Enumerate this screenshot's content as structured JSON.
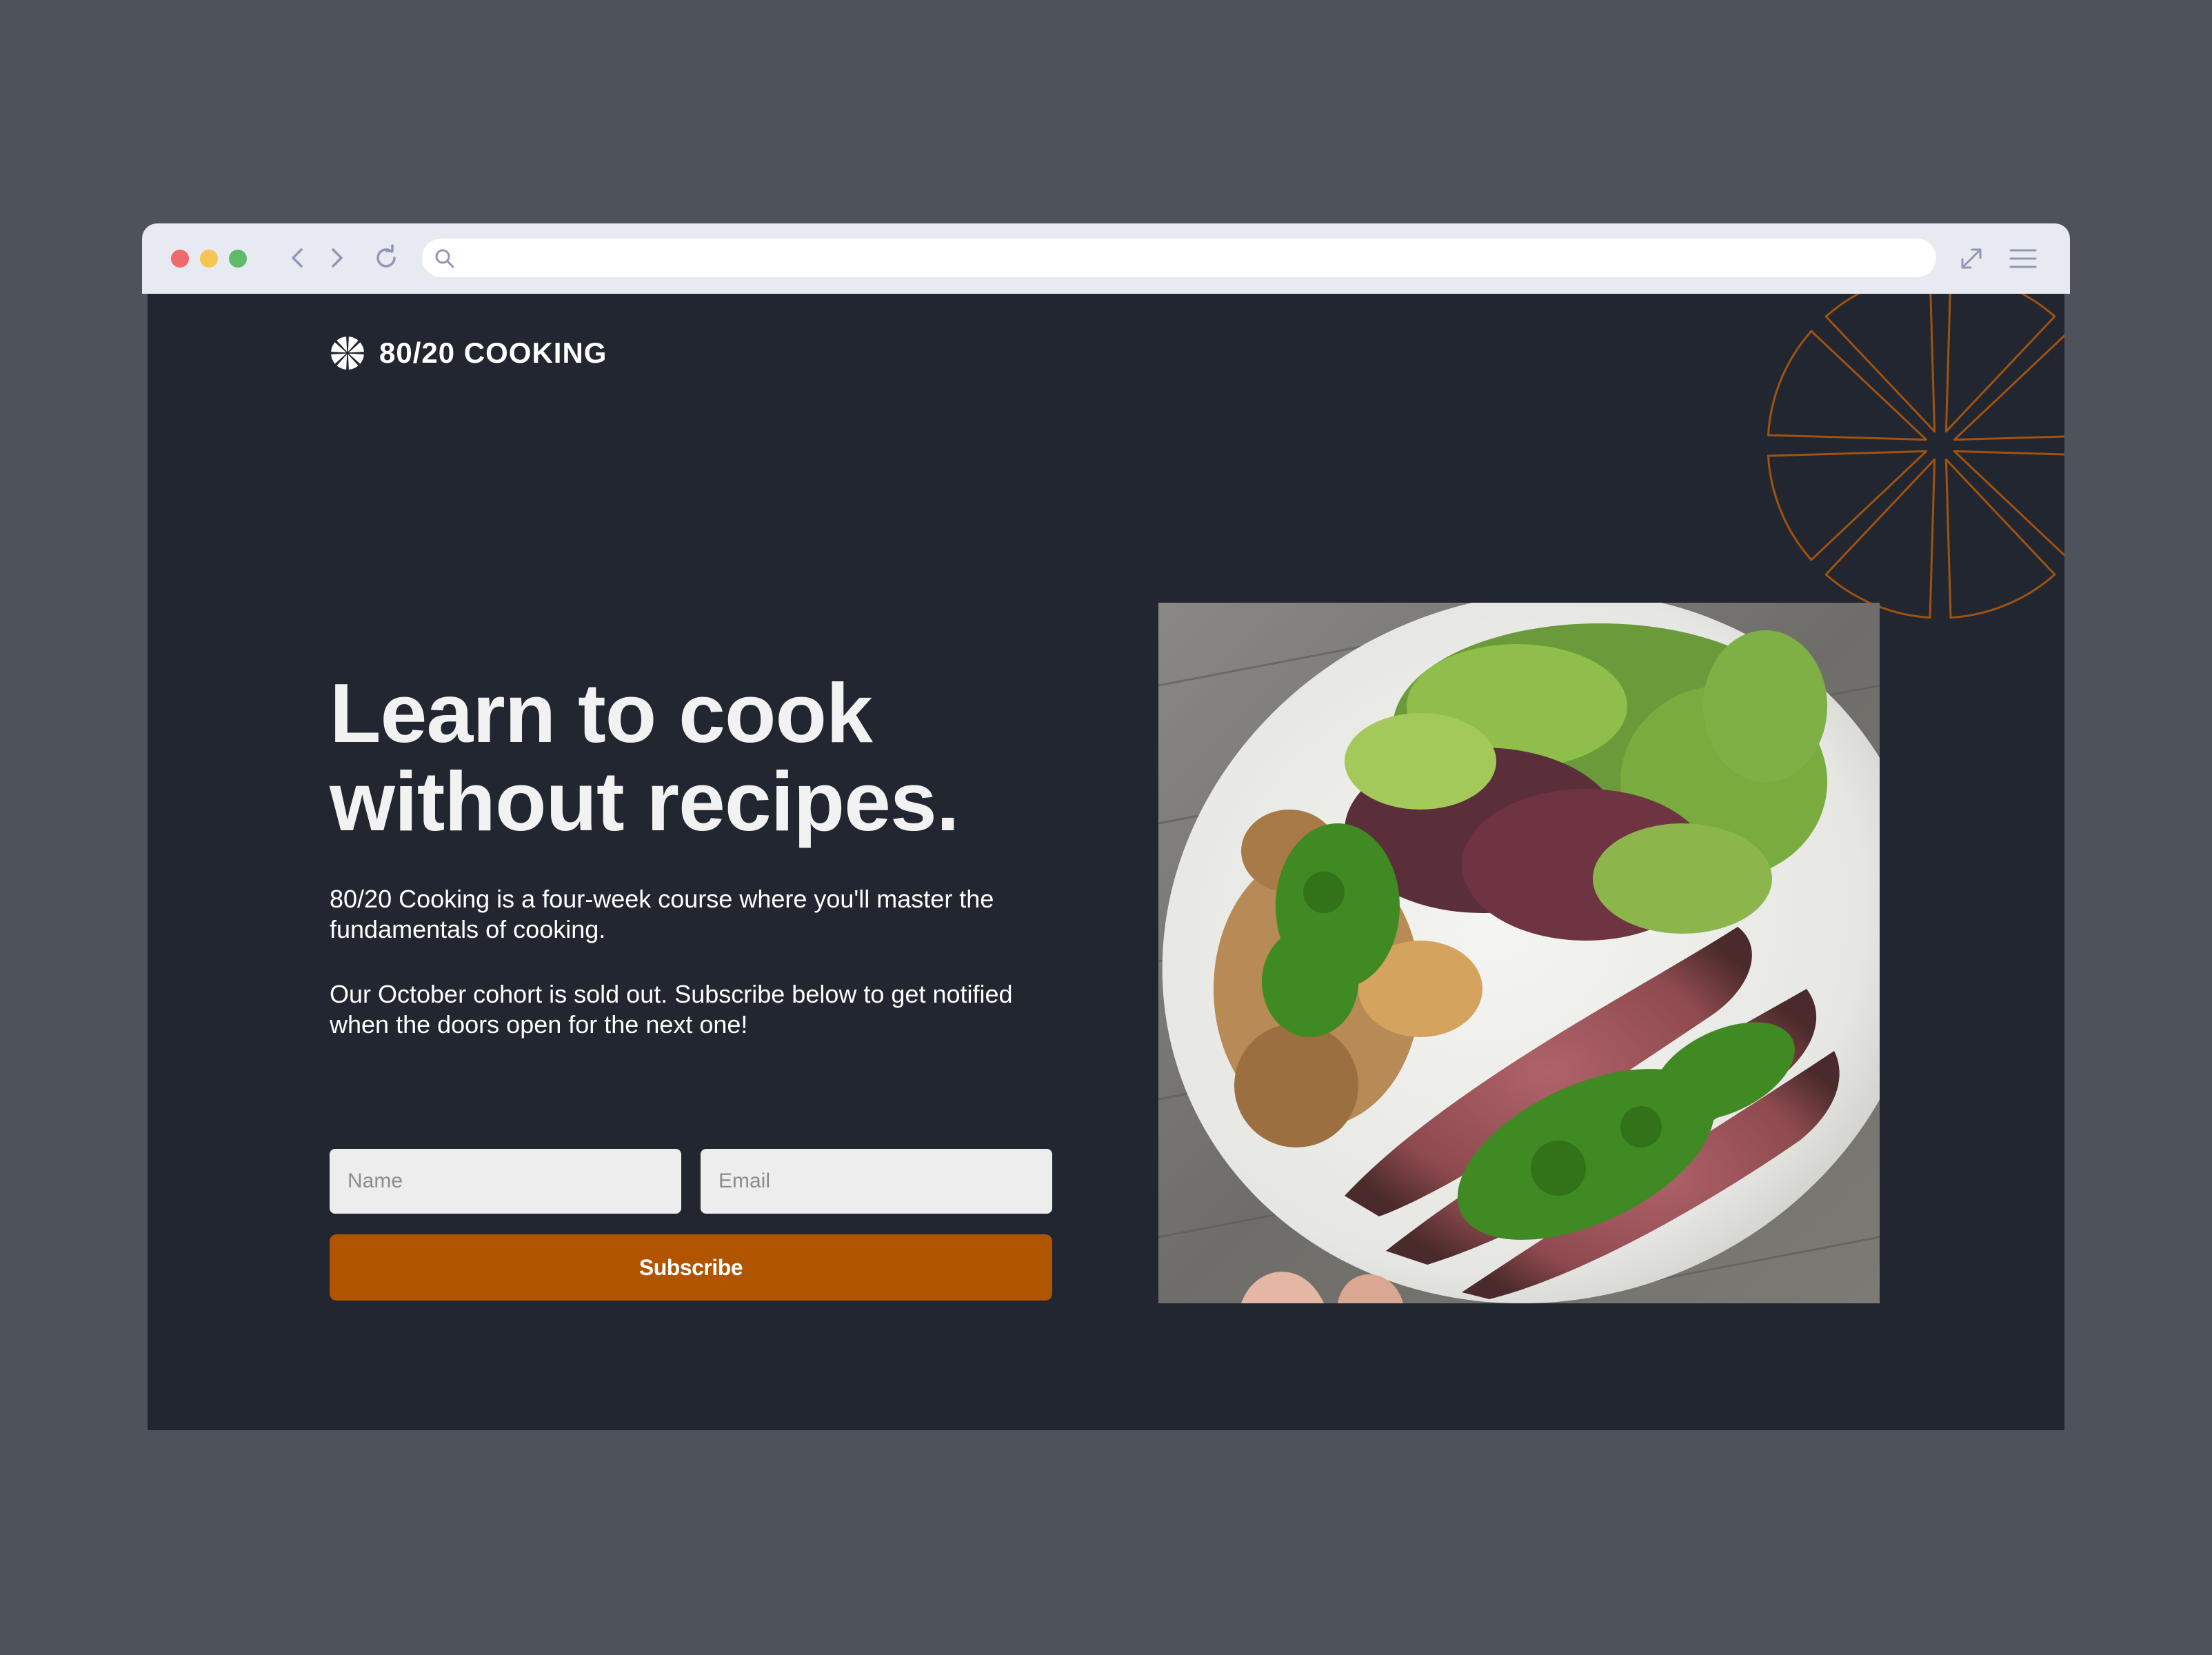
{
  "browser": {
    "url": "",
    "icons": {
      "back": "chevron-left-icon",
      "forward": "chevron-right-icon",
      "reload": "reload-icon",
      "search": "search-icon",
      "expand": "expand-icon",
      "menu": "hamburger-menu-icon"
    }
  },
  "brand": {
    "name": "80/20 COOKING",
    "logo_icon": "citrus-slice-icon"
  },
  "hero": {
    "title_line1": "Learn to cook",
    "title_line2": "without recipes.",
    "paragraph1": "80/20 Cooking is a four-week course where you'll master the fundamentals of cooking.",
    "paragraph2": "Our October cohort is sold out. Subscribe below to get notified when the doors open for the next one!"
  },
  "form": {
    "name_placeholder": "Name",
    "email_placeholder": "Email",
    "subscribe_label": "Subscribe"
  },
  "colors": {
    "page_background": "#212631",
    "outer_background": "#4e525b",
    "accent": "#b15400",
    "deco_stroke": "#a0520f",
    "browser_chrome": "#e8eaf1",
    "input_background": "#ededee"
  },
  "image": {
    "subject": "plate-of-salad-steak-and-potatoes-with-chimichurri"
  }
}
